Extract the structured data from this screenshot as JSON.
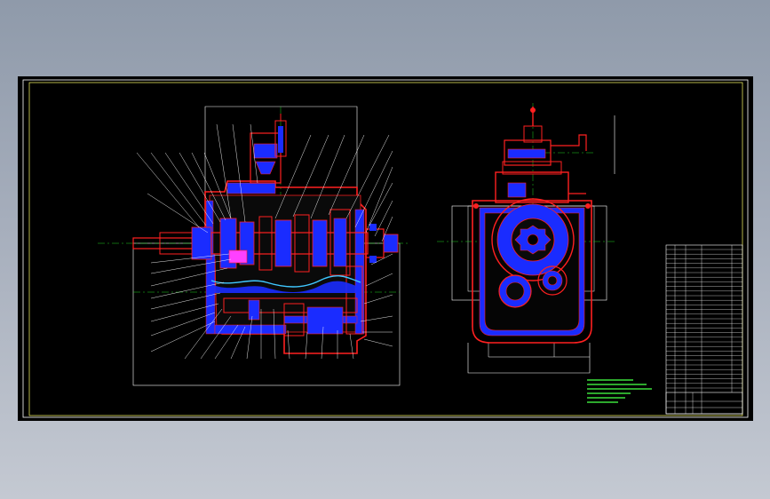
{
  "drawing": {
    "background_color": "#000000",
    "frame_color": "#ffffff",
    "border_color": "#ffff66",
    "section_fill": "#1a2cff",
    "outline_red": "#ff2020",
    "leader_white": "#ffffff",
    "centerline_green": "#20d020",
    "oil_cyan": "#40c8ff"
  },
  "views": {
    "left": "longitudinal-section-view",
    "right": "end-section-view"
  },
  "technical_notes": {
    "title": "",
    "lines": []
  },
  "title_block": {
    "title": ""
  }
}
